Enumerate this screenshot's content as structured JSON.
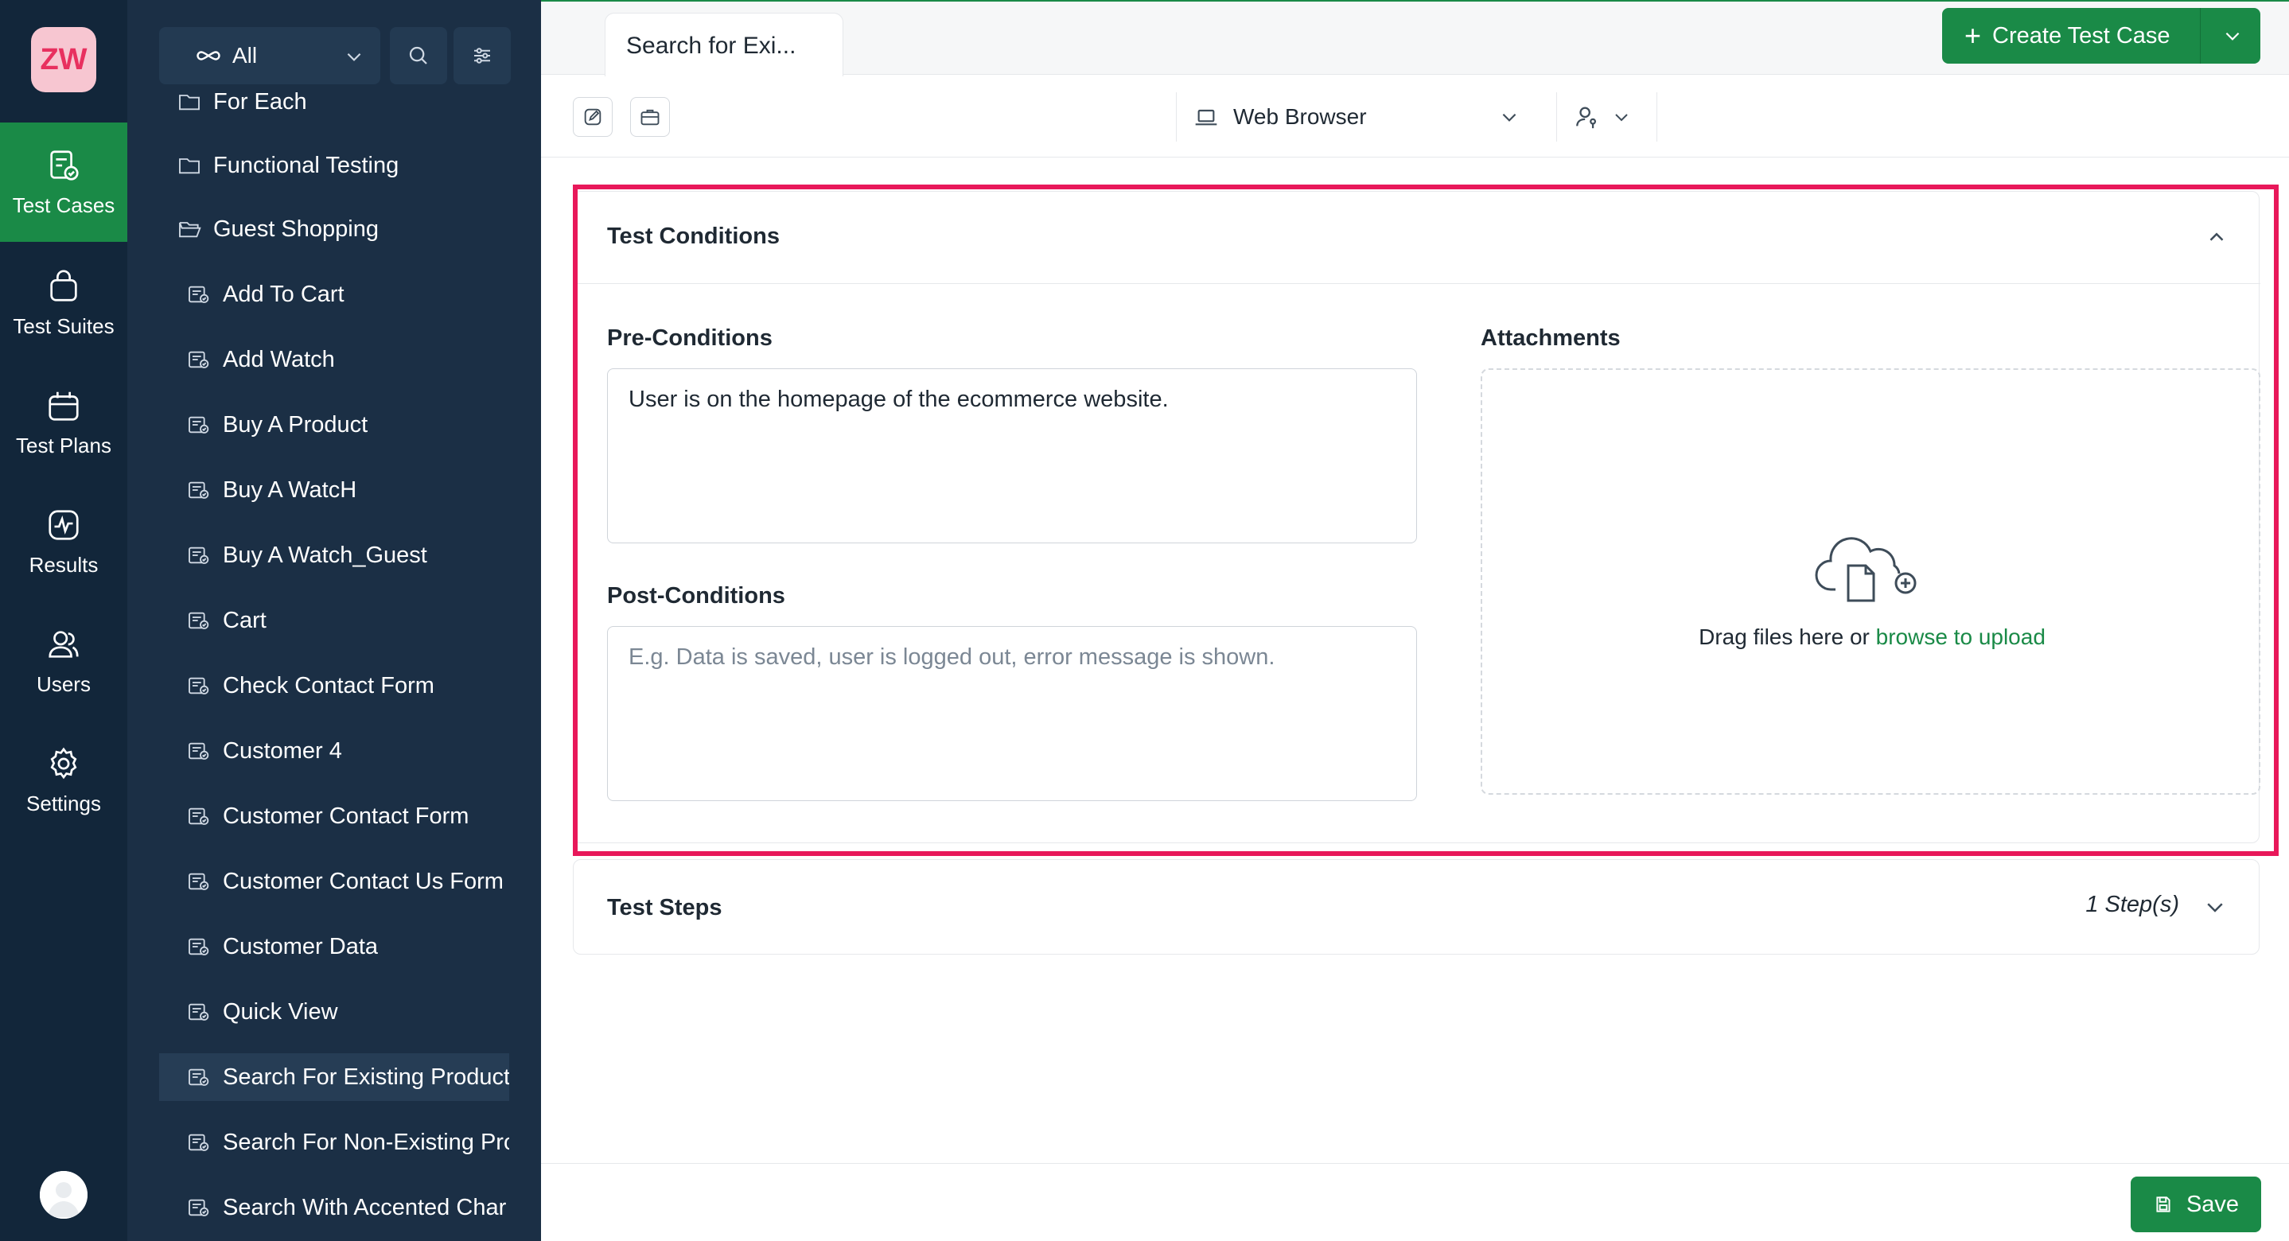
{
  "app": {
    "logo_text": "ZW"
  },
  "rail": {
    "items": [
      {
        "label": "Test Cases",
        "icon": "test-cases-icon",
        "active": true
      },
      {
        "label": "Test Suites",
        "icon": "test-suites-icon"
      },
      {
        "label": "Test Plans",
        "icon": "test-plans-icon"
      },
      {
        "label": "Results",
        "icon": "results-icon"
      },
      {
        "label": "Users",
        "icon": "users-icon"
      },
      {
        "label": "Settings",
        "icon": "gear-icon"
      }
    ]
  },
  "tree": {
    "filter_value": "All",
    "items": [
      {
        "label": "For Each",
        "type": "folder"
      },
      {
        "label": "Functional Testing",
        "type": "folder"
      },
      {
        "label": "Guest Shopping",
        "type": "folder-open"
      },
      {
        "label": "Add To Cart",
        "type": "file"
      },
      {
        "label": "Add Watch",
        "type": "file"
      },
      {
        "label": "Buy A Product",
        "type": "file"
      },
      {
        "label": "Buy A WatcH",
        "type": "file"
      },
      {
        "label": "Buy A Watch_Guest",
        "type": "file"
      },
      {
        "label": "Cart",
        "type": "file"
      },
      {
        "label": "Check Contact Form",
        "type": "file"
      },
      {
        "label": "Customer 4",
        "type": "file"
      },
      {
        "label": "Customer Contact Form",
        "type": "file"
      },
      {
        "label": "Customer Contact Us Form",
        "type": "file"
      },
      {
        "label": "Customer Data",
        "type": "file"
      },
      {
        "label": "Quick View",
        "type": "file"
      },
      {
        "label": "Search For Existing Product",
        "type": "file",
        "selected": true
      },
      {
        "label": "Search For Non-Existing Pro",
        "type": "file"
      },
      {
        "label": "Search With Accented Char",
        "type": "file"
      }
    ]
  },
  "header": {
    "tab_label": "Search for Exi...",
    "create_button": "Create Test Case"
  },
  "toolbar": {
    "platform": "Web Browser"
  },
  "conditions": {
    "title": "Test Conditions",
    "pre_label": "Pre-Conditions",
    "pre_value": "User is on the homepage of the ecommerce website.",
    "post_label": "Post-Conditions",
    "post_placeholder": "E.g. Data is saved, user is logged out, error message is shown.",
    "attachments_label": "Attachments",
    "drop_text": "Drag files here or ",
    "drop_link": "browse to upload"
  },
  "steps": {
    "title": "Test Steps",
    "count": "1 Step(s)"
  },
  "footer": {
    "save_label": "Save"
  },
  "colors": {
    "brand_green": "#1a8a47",
    "highlight": "#e8185a",
    "rail_bg": "#12263a",
    "tree_bg": "#1b2f45"
  }
}
